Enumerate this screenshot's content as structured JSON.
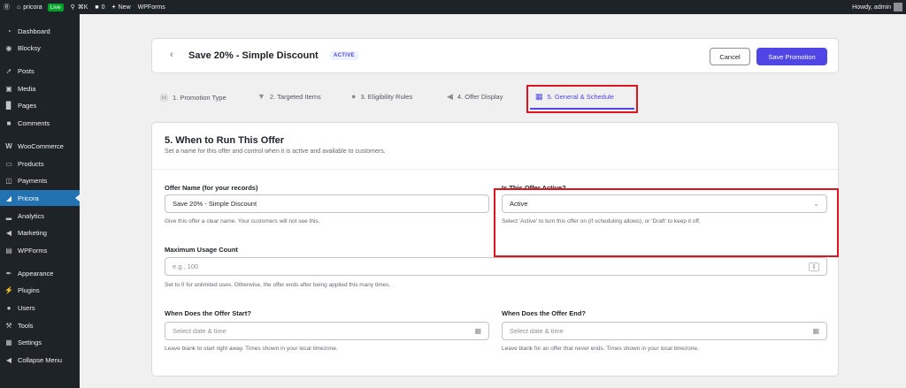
{
  "adminbar": {
    "site_name": "pricora",
    "live_badge": "Live",
    "shortcut": "⌘K",
    "comments_count": "0",
    "new_label": "New",
    "wpforms_label": "WPForms",
    "greeting": "Howdy, admin"
  },
  "sidebar": {
    "items": [
      {
        "label": "Dashboard",
        "icon": "dashboard-icon"
      },
      {
        "label": "Blocksy",
        "icon": "blocksy-icon"
      },
      {
        "label": "Posts",
        "icon": "pin-icon"
      },
      {
        "label": "Media",
        "icon": "media-icon"
      },
      {
        "label": "Pages",
        "icon": "page-icon"
      },
      {
        "label": "Comments",
        "icon": "comment-icon"
      },
      {
        "label": "WooCommerce",
        "icon": "woo-icon"
      },
      {
        "label": "Products",
        "icon": "archive-icon"
      },
      {
        "label": "Payments",
        "icon": "payment-icon"
      },
      {
        "label": "Pricora",
        "icon": "tag-icon"
      },
      {
        "label": "Analytics",
        "icon": "chart-icon"
      },
      {
        "label": "Marketing",
        "icon": "megaphone-icon"
      },
      {
        "label": "WPForms",
        "icon": "form-icon"
      },
      {
        "label": "Appearance",
        "icon": "brush-icon"
      },
      {
        "label": "Plugins",
        "icon": "plugin-icon"
      },
      {
        "label": "Users",
        "icon": "user-icon"
      },
      {
        "label": "Tools",
        "icon": "wrench-icon"
      },
      {
        "label": "Settings",
        "icon": "settings-icon"
      },
      {
        "label": "Collapse Menu",
        "icon": "collapse-icon"
      }
    ],
    "active": "Pricora"
  },
  "header": {
    "title": "Save 20% - Simple Discount",
    "status_badge": "ACTIVE",
    "cancel_label": "Cancel",
    "save_label": "Save Promotion"
  },
  "tabs": [
    {
      "label": "1. Promotion Type",
      "icon": "dollar-circle-icon"
    },
    {
      "label": "2. Targeted Items",
      "icon": "filter-icon"
    },
    {
      "label": "3. Eligibility Rules",
      "icon": "users-icon"
    },
    {
      "label": "4. Offer Display",
      "icon": "megaphone-icon"
    },
    {
      "label": "5. General & Schedule",
      "icon": "calendar-grid-icon"
    }
  ],
  "active_tab": "5. General & Schedule",
  "form": {
    "section_title": "5. When to Run This Offer",
    "section_subtitle": "Set a name for this offer and control when it is active and available to customers.",
    "offer_name": {
      "label": "Offer Name (for your records)",
      "value": "Save 20% - Simple Discount",
      "help": "Give this offer a clear name. Your customers will not see this."
    },
    "offer_active": {
      "label": "Is This Offer Active?",
      "value": "Active",
      "help": "Select 'Active' to turn this offer on (if scheduling allows), or 'Draft' to keep it off."
    },
    "max_usage": {
      "label": "Maximum Usage Count",
      "placeholder": "e.g., 100",
      "help": "Set to 0 for unlimited uses. Otherwise, the offer ends after being applied this many times."
    },
    "start": {
      "label": "When Does the Offer Start?",
      "placeholder": "Select date & time",
      "help": "Leave blank to start right away. Times shown in your local timezone."
    },
    "end": {
      "label": "When Does the Offer End?",
      "placeholder": "Select date & time",
      "help": "Leave blank for an offer that never ends. Times shown in your local timezone."
    }
  },
  "colors": {
    "accent": "#4f46e5",
    "highlight_box": "#e0141e",
    "admin_dark": "#1d2327",
    "sidebar_active": "#2271b1"
  }
}
